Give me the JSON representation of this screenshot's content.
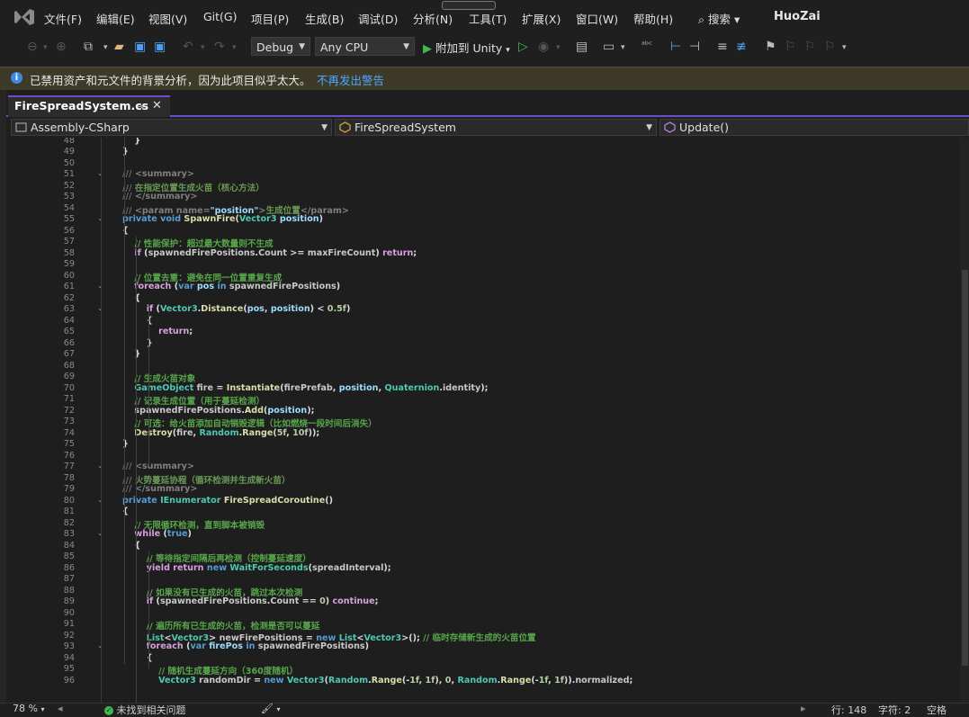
{
  "menu": {
    "items": [
      "文件(F)",
      "编辑(E)",
      "视图(V)",
      "Git(G)",
      "项目(P)",
      "生成(B)",
      "调试(D)",
      "分析(N)",
      "工具(T)",
      "扩展(X)",
      "窗口(W)",
      "帮助(H)"
    ],
    "search_label": "搜索",
    "project_name": "HuoZai"
  },
  "toolbar": {
    "config": "Debug",
    "platform": "Any CPU",
    "attach_label": "附加到 Unity"
  },
  "infobar": {
    "message": "已禁用资产和元文件的背景分析，因为此项目似乎太大。",
    "link": "不再发出警告"
  },
  "tab": {
    "title": "FireSpreadSystem.cs"
  },
  "navbar": {
    "project": "Assembly-CSharp",
    "type": "FireSpreadSystem",
    "member": "Update()"
  },
  "editor": {
    "lines": [
      {
        "n": "48",
        "t": "            }"
      },
      {
        "n": "49",
        "t": "        }"
      },
      {
        "n": "50",
        "t": ""
      },
      {
        "n": "51",
        "t": "        /// <summary>"
      },
      {
        "n": "52",
        "t": "        /// 在指定位置生成火苗（核心方法）"
      },
      {
        "n": "53",
        "t": "        /// </summary>"
      },
      {
        "n": "54",
        "t": "        /// <param name=\"position\">生成位置</param>"
      },
      {
        "n": "55",
        "t": "        private void SpawnFire(Vector3 position)"
      },
      {
        "n": "56",
        "t": "        {"
      },
      {
        "n": "57",
        "t": "            // 性能保护：超过最大数量则不生成"
      },
      {
        "n": "58",
        "t": "            if (spawnedFirePositions.Count >= maxFireCount) return;"
      },
      {
        "n": "59",
        "t": ""
      },
      {
        "n": "60",
        "t": "            // 位置去重：避免在同一位置重复生成"
      },
      {
        "n": "61",
        "t": "            foreach (var pos in spawnedFirePositions)"
      },
      {
        "n": "62",
        "t": "            {"
      },
      {
        "n": "63",
        "t": "                if (Vector3.Distance(pos, position) < 0.5f)"
      },
      {
        "n": "64",
        "t": "                {"
      },
      {
        "n": "65",
        "t": "                    return;"
      },
      {
        "n": "66",
        "t": "                }"
      },
      {
        "n": "67",
        "t": "            }"
      },
      {
        "n": "68",
        "t": ""
      },
      {
        "n": "69",
        "t": "            // 生成火苗对象"
      },
      {
        "n": "70",
        "t": "            GameObject fire = Instantiate(firePrefab, position, Quaternion.identity);"
      },
      {
        "n": "71",
        "t": "            // 记录生成位置（用于蔓延检测）"
      },
      {
        "n": "72",
        "t": "            spawnedFirePositions.Add(position);"
      },
      {
        "n": "73",
        "t": "            // 可选：给火苗添加自动销毁逻辑（比如燃烧一段时间后消失）"
      },
      {
        "n": "74",
        "t": "            Destroy(fire, Random.Range(5f, 10f));"
      },
      {
        "n": "75",
        "t": "        }"
      },
      {
        "n": "76",
        "t": ""
      },
      {
        "n": "77",
        "t": "        /// <summary>"
      },
      {
        "n": "78",
        "t": "        /// 火势蔓延协程（循环检测并生成新火苗）"
      },
      {
        "n": "79",
        "t": "        /// </summary>"
      },
      {
        "n": "80",
        "t": "        private IEnumerator FireSpreadCoroutine()"
      },
      {
        "n": "81",
        "t": "        {"
      },
      {
        "n": "82",
        "t": "            // 无限循环检测，直到脚本被销毁"
      },
      {
        "n": "83",
        "t": "            while (true)"
      },
      {
        "n": "84",
        "t": "            {"
      },
      {
        "n": "85",
        "t": "                // 等待指定间隔后再检测（控制蔓延速度）"
      },
      {
        "n": "86",
        "t": "                yield return new WaitForSeconds(spreadInterval);"
      },
      {
        "n": "87",
        "t": ""
      },
      {
        "n": "88",
        "t": "                // 如果没有已生成的火苗，跳过本次检测"
      },
      {
        "n": "89",
        "t": "                if (spawnedFirePositions.Count == 0) continue;"
      },
      {
        "n": "90",
        "t": ""
      },
      {
        "n": "91",
        "t": "                // 遍历所有已生成的火苗，检测是否可以蔓延"
      },
      {
        "n": "92",
        "t": "                List<Vector3> newFirePositions = new List<Vector3>(); // 临时存储新生成的火苗位置"
      },
      {
        "n": "93",
        "t": "                foreach (var firePos in spawnedFirePositions)"
      },
      {
        "n": "94",
        "t": "                {"
      },
      {
        "n": "95",
        "t": "                    // 随机生成蔓延方向（360度随机）"
      },
      {
        "n": "96",
        "t": "                    Vector3 randomDir = new Vector3(Random.Range(-1f, 1f), 0, Random.Range(-1f, 1f)).normalized;"
      }
    ],
    "fold_lines": [
      "51",
      "55",
      "61",
      "63",
      "77",
      "80",
      "83",
      "93"
    ]
  },
  "statusbar": {
    "zoom": "78 %",
    "issues": "未找到相关问题",
    "line": "行: 148",
    "char": "字符: 2",
    "indent": "空格"
  },
  "colors": {
    "keyword": "#569cd6",
    "control": "#d8a0df",
    "type": "#4ec9b0",
    "method": "#dcdcaa",
    "comment": "#57a64a",
    "doc": "#6a9955",
    "string": "#d69d85",
    "number": "#b5cea8",
    "field": "#c8c8c8",
    "param": "#9cdcfe",
    "accent": "#6b4ec8"
  }
}
